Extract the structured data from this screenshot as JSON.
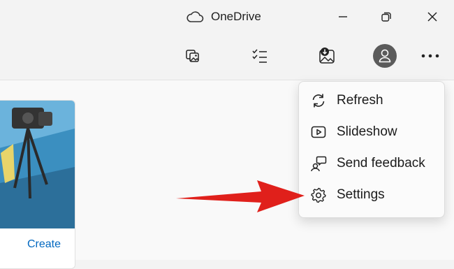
{
  "window": {
    "title": "OneDrive",
    "controls": [
      "minimize-icon",
      "restore-icon",
      "close-icon"
    ]
  },
  "toolbar": {
    "buttons": [
      "import-photos-icon",
      "select-icon",
      "save-image-icon",
      "account-avatar",
      "more-options-icon"
    ]
  },
  "gallery": {
    "card_action": "Create"
  },
  "menu": {
    "items": [
      {
        "label": "Refresh",
        "icon": "refresh-icon"
      },
      {
        "label": "Slideshow",
        "icon": "slideshow-icon"
      },
      {
        "label": "Send feedback",
        "icon": "feedback-icon"
      },
      {
        "label": "Settings",
        "icon": "gear-icon"
      }
    ]
  },
  "colors": {
    "accent": "#0067c0",
    "annotation_arrow": "#e0201b"
  }
}
